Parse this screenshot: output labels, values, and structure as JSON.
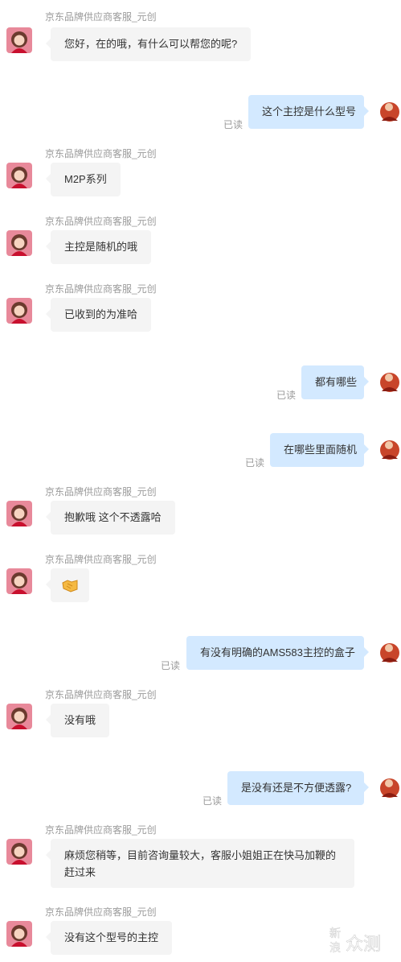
{
  "agent_name": "京东品牌供应商客服_元创",
  "read_label": "已读",
  "messages": {
    "m1": "您好，在的哦，有什么可以帮您的呢?",
    "m2": "这个主控是什么型号",
    "m3": "M2P系列",
    "m4": "主控是随机的哦",
    "m5": "已收到的为准哈",
    "m6": "都有哪些",
    "m7": "在哪些里面随机",
    "m8": "抱歉哦 这个不透露哈",
    "m9": "🤝",
    "m10": "有没有明确的AMS583主控的盒子",
    "m11": "没有哦",
    "m12": "是没有还是不方便透露?",
    "m13": "麻烦您稍等，目前咨询量较大，客服小姐姐正在快马加鞭的赶过来",
    "m14": "没有这个型号的主控"
  },
  "watermark": {
    "line1": "新",
    "line2": "浪",
    "text": "众测"
  }
}
